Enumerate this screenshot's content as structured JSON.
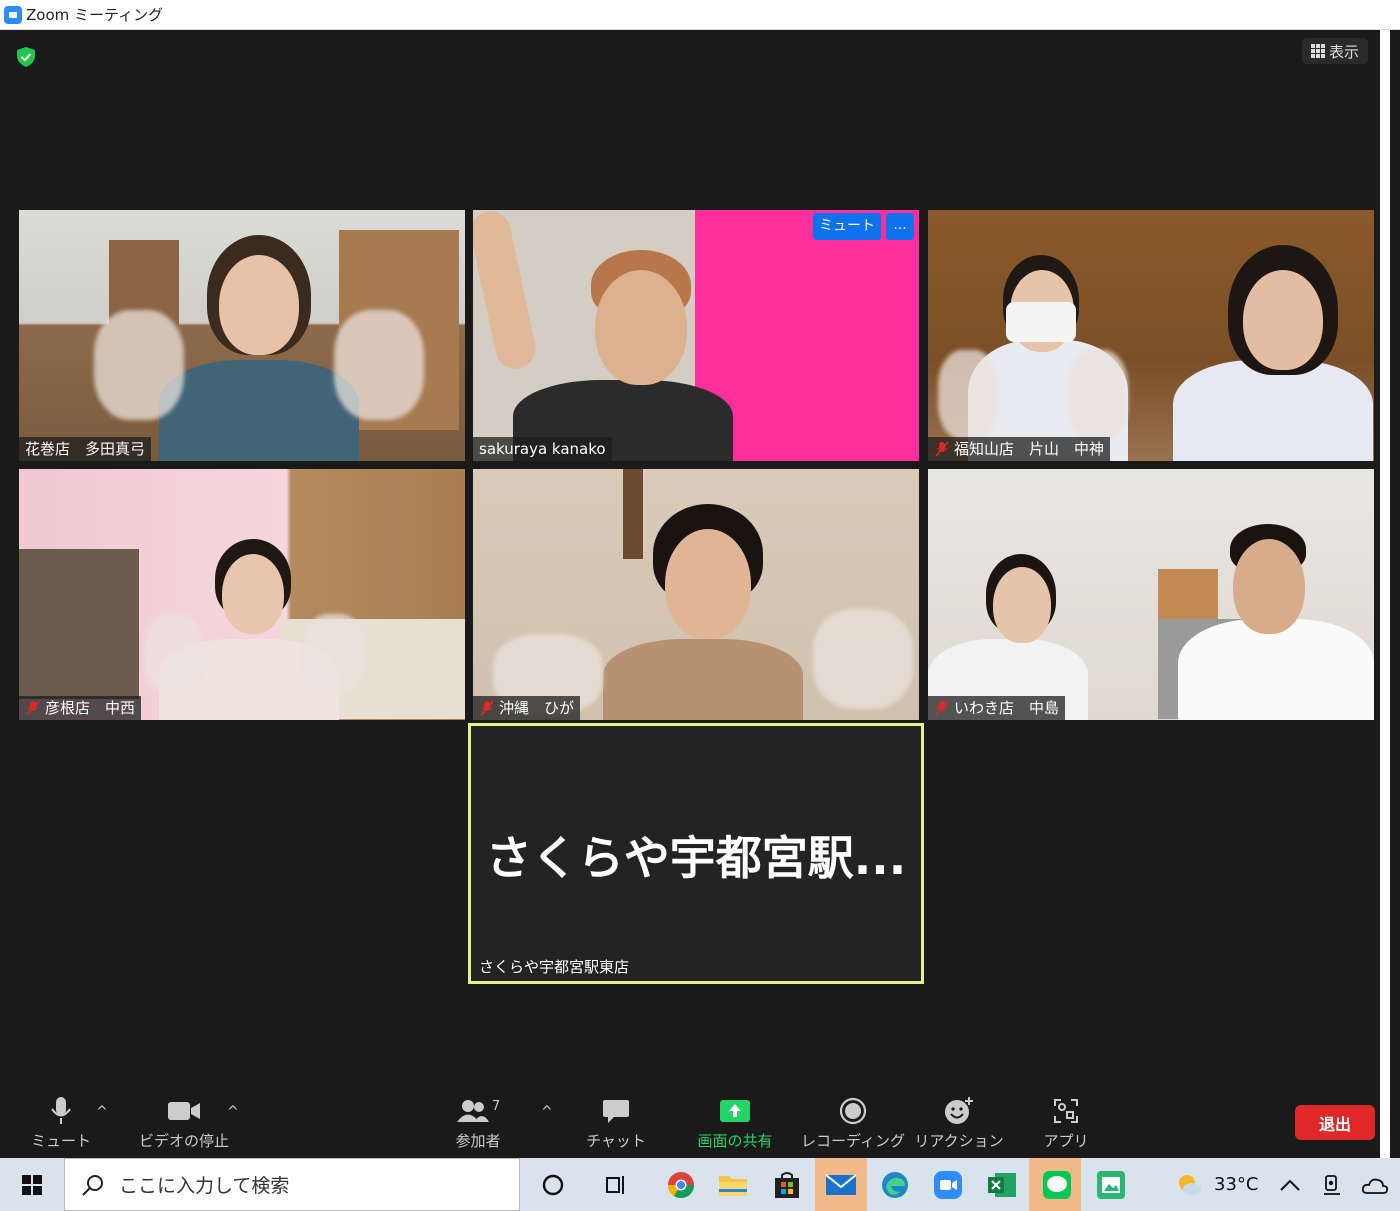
{
  "window": {
    "title": "Zoom ミーティング"
  },
  "top_bar": {
    "view_label": "表示"
  },
  "participants": [
    {
      "name": "花巻店　多田真弓",
      "muted": false
    },
    {
      "name": "sakuraya kanako",
      "muted": false,
      "hover_mute": "ミュート",
      "hover_more": "..."
    },
    {
      "name": "福知山店　片山　中神",
      "muted": true
    },
    {
      "name": "彦根店　中西",
      "muted": true
    },
    {
      "name": "沖縄　ひが",
      "muted": true
    },
    {
      "name": "いわき店　中島",
      "muted": true
    }
  ],
  "active_speaker": {
    "big_text": "さくらや宇都宮駅...",
    "name": "さくらや宇都宮駅東店"
  },
  "toolbar": {
    "mute": "ミュート",
    "video": "ビデオの停止",
    "participants": "参加者",
    "participant_count": "7",
    "chat": "チャット",
    "share": "画面の共有",
    "record": "レコーディング",
    "reactions": "リアクション",
    "apps": "アプリ",
    "leave": "退出"
  },
  "taskbar": {
    "search_placeholder": "ここに入力して検索",
    "temperature": "33°C"
  },
  "colors": {
    "share_green": "#25d366",
    "leave_red": "#e02828",
    "active_border": "#e8f08c",
    "accent_blue": "#0e72ed"
  }
}
